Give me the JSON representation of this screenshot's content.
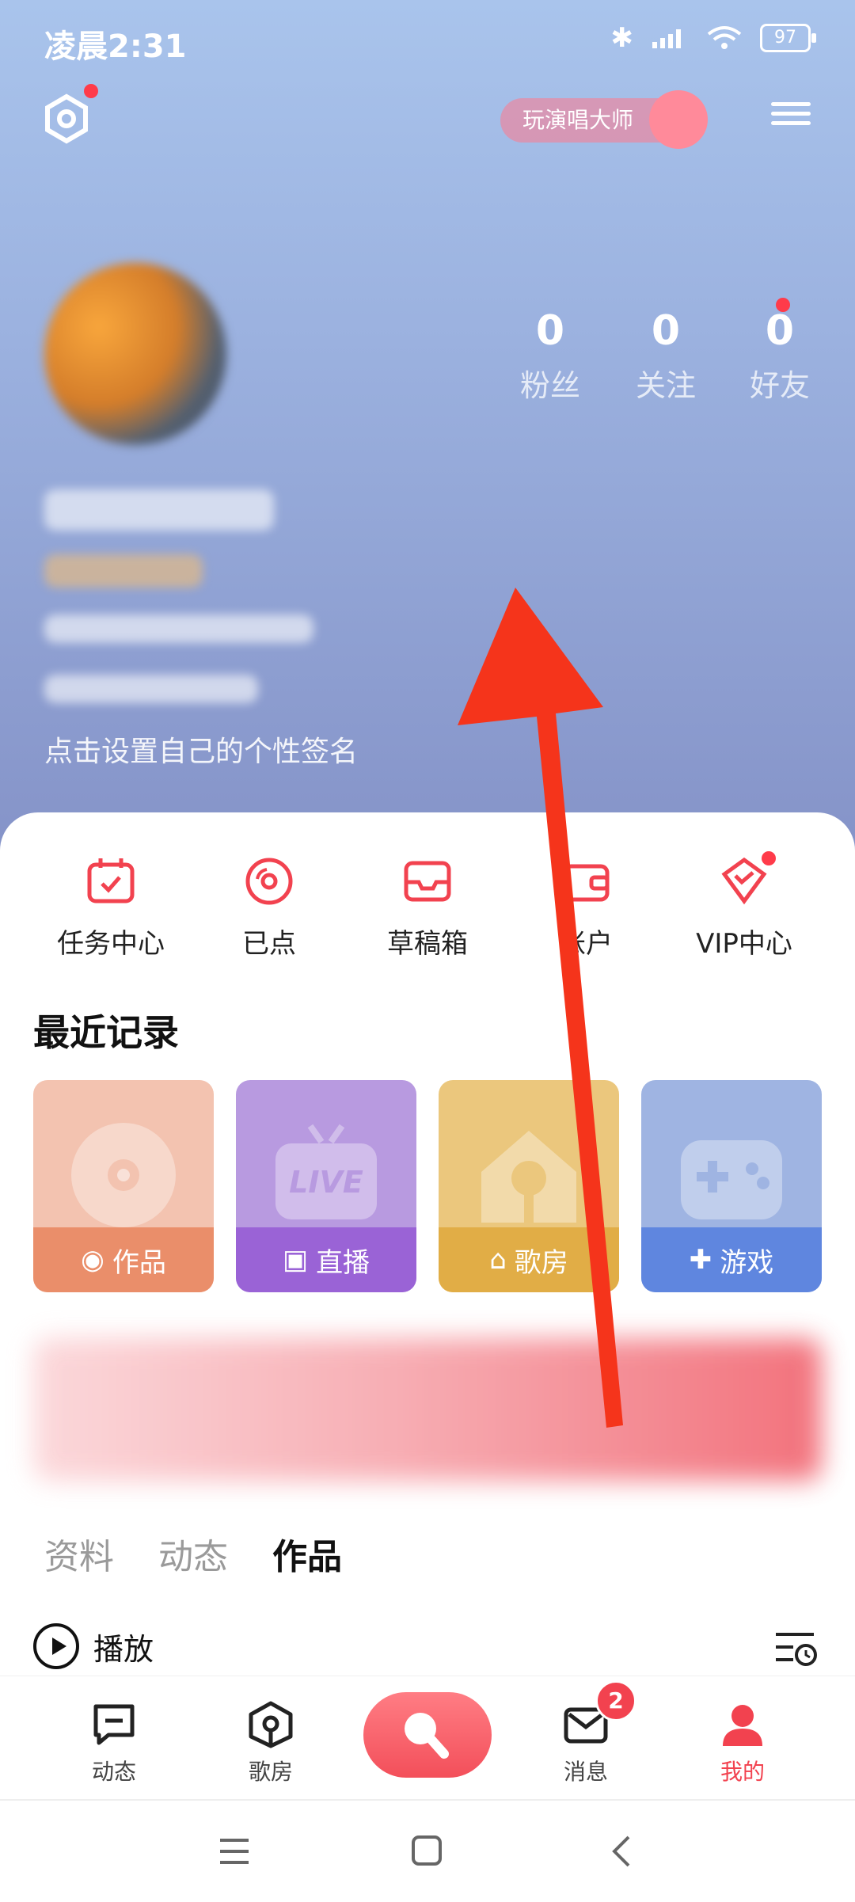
{
  "status": {
    "time": "凌晨2:31",
    "battery": "97"
  },
  "header": {
    "master_label": "玩演唱大师"
  },
  "stats": [
    {
      "value": "0",
      "label": "粉丝"
    },
    {
      "value": "0",
      "label": "关注"
    },
    {
      "value": "0",
      "label": "好友"
    }
  ],
  "profile": {
    "signature_prompt": "点击设置自己的个性签名"
  },
  "quick_actions": [
    {
      "label": "任务中心"
    },
    {
      "label": "已点"
    },
    {
      "label": "草稿箱"
    },
    {
      "label": "账户"
    },
    {
      "label": "VIP中心"
    }
  ],
  "recent": {
    "title": "最近记录",
    "tiles": [
      {
        "label": "作品",
        "color": "#f3c3b0",
        "bar": "#ea8e6a"
      },
      {
        "label": "直播",
        "color": "#b89ae0",
        "bar": "#9a63d6"
      },
      {
        "label": "歌房",
        "color": "#ebc77d",
        "bar": "#e1ad46"
      },
      {
        "label": "游戏",
        "color": "#9fb4e2",
        "bar": "#5f86df"
      }
    ]
  },
  "tabs": [
    {
      "label": "资料"
    },
    {
      "label": "动态"
    },
    {
      "label": "作品"
    }
  ],
  "play": {
    "label": "播放"
  },
  "nav": [
    {
      "label": "动态"
    },
    {
      "label": "歌房"
    },
    {
      "label": "消息",
      "badge": "2"
    },
    {
      "label": "我的"
    }
  ],
  "colors": {
    "accent": "#f2424f",
    "arrow": "#f5341b"
  }
}
